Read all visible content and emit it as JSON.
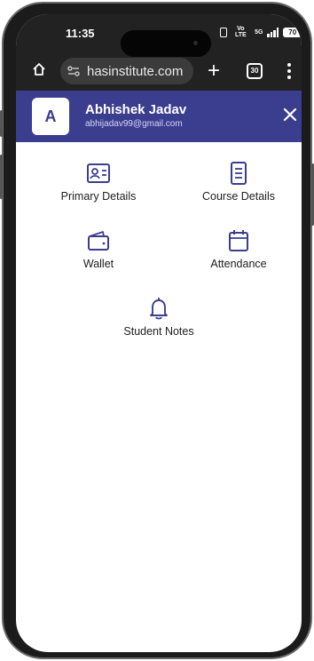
{
  "status_bar": {
    "time": "11:35",
    "volte": "Vo LTE",
    "network": "5G",
    "battery": "70"
  },
  "browser": {
    "url": "hasinstitute.com",
    "tab_count": "30"
  },
  "header": {
    "avatar_letter": "A",
    "user_name": "Abhishek Jadav",
    "user_email": "abhijadav99@gmail.com"
  },
  "menu": {
    "items": [
      {
        "label": "Primary Details",
        "icon": "id-card-icon"
      },
      {
        "label": "Course Details",
        "icon": "document-icon"
      },
      {
        "label": "Wallet",
        "icon": "wallet-icon"
      },
      {
        "label": "Attendance",
        "icon": "calendar-icon"
      },
      {
        "label": "Student Notes",
        "icon": "bell-icon"
      }
    ]
  },
  "colors": {
    "header_bg": "#3b3d8f",
    "icon_color": "#3b3d8f",
    "browser_bg": "#222222"
  }
}
